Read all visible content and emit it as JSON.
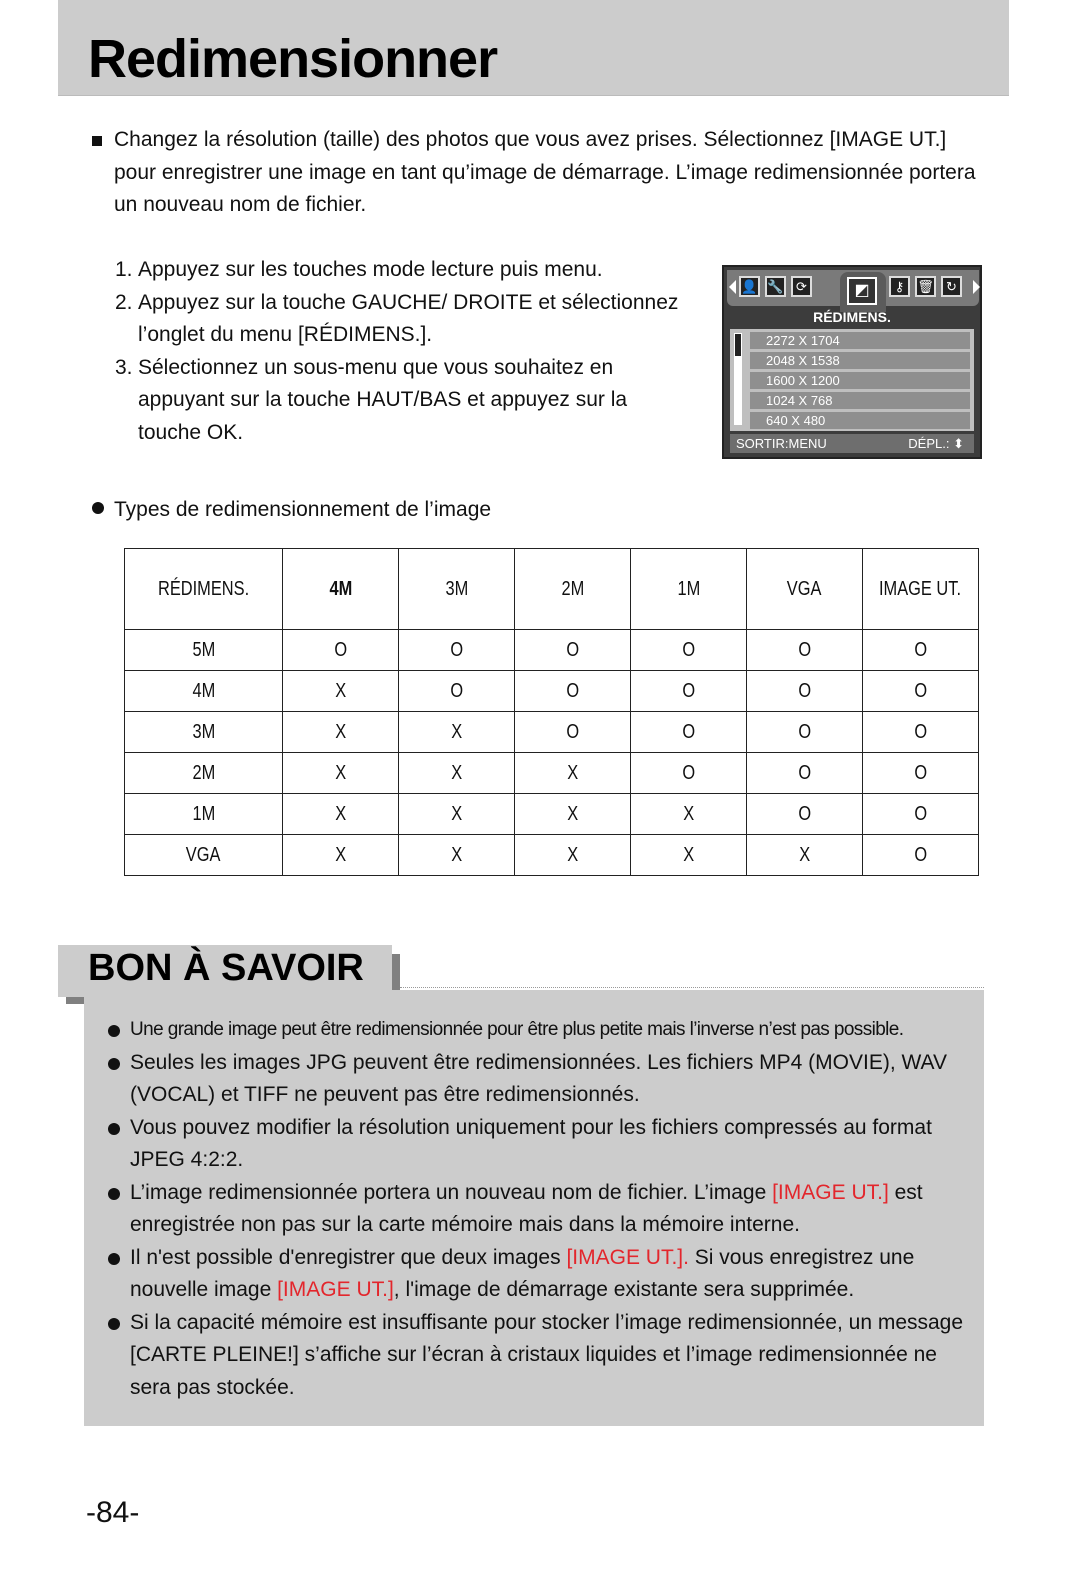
{
  "page": {
    "title": "Redimensionner",
    "intro": "Changez la résolution (taille) des photos que vous avez prises. Sélectionnez [IMAGE UT.] pour enregistrer une image en tant qu’image de démarrage. L’image redimensionnée portera un nouveau nom de fichier.",
    "steps": [
      {
        "num": "1.",
        "text": "Appuyez sur les touches mode lecture puis menu."
      },
      {
        "num": "2.",
        "text": "Appuyez sur la touche GAUCHE/ DROITE et sélectionnez l’onglet du menu [RÉDIMENS.]."
      },
      {
        "num": "3.",
        "text": "Sélectionnez un sous-menu que vous souhaitez en appuyant sur la touche HAUT/BAS et appuyez sur la touche OK."
      }
    ],
    "types_label": "Types de redimensionnement de l’image",
    "page_number": "-84-"
  },
  "camera_screen": {
    "tab_icons": [
      "person-icon",
      "wrench-icon",
      "rotate-icon",
      "resize-icon",
      "key-icon",
      "delete-icon",
      "effect-icon"
    ],
    "active_tab": "resize-icon",
    "header": "RÉDIMENS.",
    "options": [
      "2272 X 1704",
      "2048 X 1538",
      "1600 X 1200",
      "1024 X 768",
      "640 X 480"
    ],
    "footer_left": "SORTIR:MENU",
    "footer_right": "DÉPL.: ⬍"
  },
  "table": {
    "headers": [
      "RÉDIMENS.",
      "4M",
      "3M",
      "2M",
      "1M",
      "VGA",
      "IMAGE UT."
    ],
    "rows": [
      [
        "5M",
        "O",
        "O",
        "O",
        "O",
        "O",
        "O"
      ],
      [
        "4M",
        "X",
        "O",
        "O",
        "O",
        "O",
        "O"
      ],
      [
        "3M",
        "X",
        "X",
        "O",
        "O",
        "O",
        "O"
      ],
      [
        "2M",
        "X",
        "X",
        "X",
        "O",
        "O",
        "O"
      ],
      [
        "1M",
        "X",
        "X",
        "X",
        "X",
        "O",
        "O"
      ],
      [
        "VGA",
        "X",
        "X",
        "X",
        "X",
        "X",
        "O"
      ]
    ]
  },
  "tips": {
    "title": "BON À SAVOIR",
    "accent_color": "#e3262c",
    "items": [
      {
        "parts": [
          {
            "t": "Une grande image peut être redimensionnée pour être plus petite mais l’inverse n’est pas possible."
          }
        ]
      },
      {
        "parts": [
          {
            "t": "Seules les images JPG peuvent être redimensionnées. Les fichiers MP4 (MOVIE), WAV (VOCAL) et TIFF ne peuvent pas être redimensionnés."
          }
        ]
      },
      {
        "parts": [
          {
            "t": "Vous pouvez modifier la résolution uniquement pour les fichiers compressés au format JPEG 4:2:2."
          }
        ]
      },
      {
        "parts": [
          {
            "t": "L’image redimensionnée portera un nouveau nom de fichier. L’image "
          },
          {
            "t": "[IMAGE UT.]",
            "red": true
          },
          {
            "t": " est enregistrée non pas sur la carte mémoire mais dans la mémoire interne."
          }
        ]
      },
      {
        "parts": [
          {
            "t": "Il n'est possible d'enregistrer que deux images "
          },
          {
            "t": "[IMAGE UT.].",
            "red": true
          },
          {
            "t": " Si vous enregistrez une nouvelle image "
          },
          {
            "t": "[IMAGE UT.]",
            "red": true
          },
          {
            "t": ", l'image de démarrage existante sera supprimée."
          }
        ]
      },
      {
        "parts": [
          {
            "t": "Si la capacité mémoire est insuffisante pour stocker l’image redimensionnée, un message [CARTE PLEINE!] s’affiche sur l’écran à cristaux liquides et l’image redimensionnée ne sera pas stockée."
          }
        ]
      }
    ]
  }
}
